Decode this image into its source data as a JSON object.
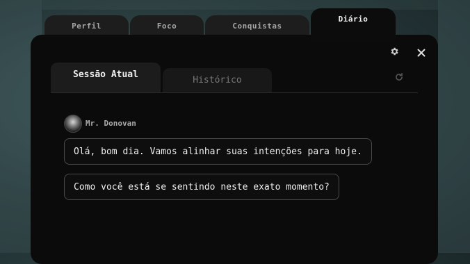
{
  "top_tabs": [
    {
      "label": "Perfil",
      "active": false
    },
    {
      "label": "Foco",
      "active": false
    },
    {
      "label": "Conquistas",
      "active": false
    },
    {
      "label": "Diário",
      "active": true
    }
  ],
  "panel": {
    "settings_icon": "gear-icon",
    "close_icon": "close-icon",
    "refresh_icon": "refresh-icon",
    "sub_tabs": [
      {
        "label": "Sessão Atual",
        "active": true
      },
      {
        "label": "Histórico",
        "active": false
      }
    ]
  },
  "chat": {
    "sender": "Mr. Donovan",
    "messages": [
      "Olá, bom dia. Vamos alinhar suas intenções para hoje.",
      "Como você está se sentindo neste exato momento?"
    ]
  },
  "colors": {
    "panel_bg": "#0b0b0b",
    "tab_bg": "#1d1d1d",
    "accent_text": "#f0f0f0"
  }
}
